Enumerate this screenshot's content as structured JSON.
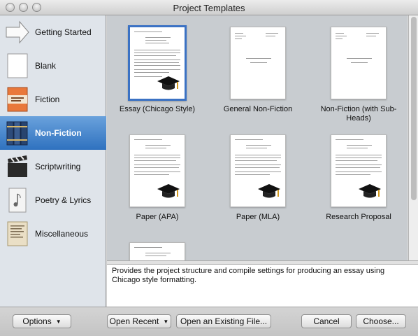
{
  "window": {
    "title": "Project Templates"
  },
  "sidebar": {
    "items": [
      {
        "label": "Getting Started",
        "icon": "arrow-icon",
        "selected": false
      },
      {
        "label": "Blank",
        "icon": "blank-page-icon",
        "selected": false
      },
      {
        "label": "Fiction",
        "icon": "book-icon",
        "selected": false
      },
      {
        "label": "Non-Fiction",
        "icon": "books-icon",
        "selected": true
      },
      {
        "label": "Scriptwriting",
        "icon": "clapperboard-icon",
        "selected": false
      },
      {
        "label": "Poetry & Lyrics",
        "icon": "music-page-icon",
        "selected": false
      },
      {
        "label": "Miscellaneous",
        "icon": "notes-icon",
        "selected": false
      }
    ]
  },
  "templates": [
    {
      "name": "Essay (Chicago Style)",
      "selected": true
    },
    {
      "name": "General Non-Fiction",
      "selected": false
    },
    {
      "name": "Non-Fiction (with Sub-Heads)",
      "selected": false
    },
    {
      "name": "Paper (APA)",
      "selected": false
    },
    {
      "name": "Paper (MLA)",
      "selected": false
    },
    {
      "name": "Research Proposal",
      "selected": false
    }
  ],
  "description": "Provides the project structure and compile settings for producing an essay using Chicago style formatting.",
  "buttons": {
    "options": "Options",
    "open_recent": "Open Recent",
    "open_existing": "Open an Existing File...",
    "cancel": "Cancel",
    "choose": "Choose..."
  },
  "colors": {
    "selection": "#2f72bf",
    "accent": "#3b72c4"
  }
}
